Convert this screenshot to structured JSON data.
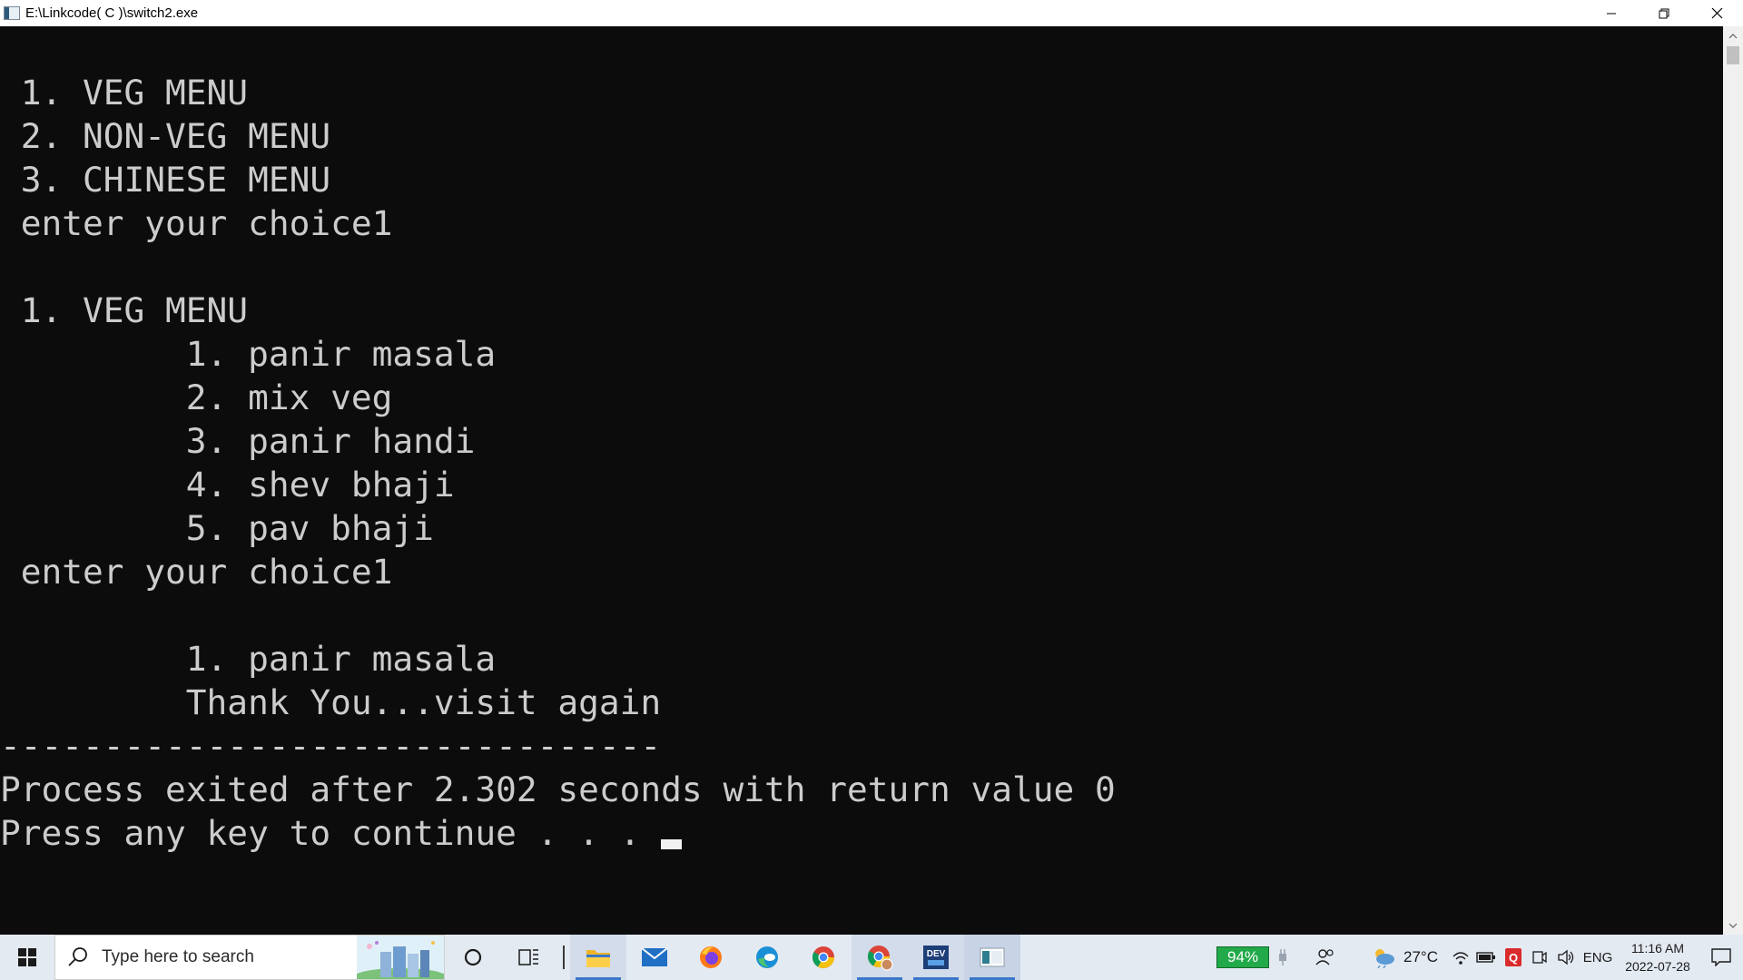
{
  "window": {
    "title": "E:\\Linkcode( C )\\switch2.exe"
  },
  "console": {
    "lines": [
      " 1. VEG MENU",
      " 2. NON-VEG MENU",
      " 3. CHINESE MENU",
      " enter your choice1",
      "",
      " 1. VEG MENU",
      "         1. panir masala",
      "         2. mix veg",
      "         3. panir handi",
      "         4. shev bhaji",
      "         5. pav bhaji",
      " enter your choice1",
      "",
      "         1. panir masala",
      "         Thank You...visit again",
      "--------------------------------",
      "Process exited after 2.302 seconds with return value 0",
      "Press any key to continue . . ."
    ]
  },
  "taskbar": {
    "search_placeholder": "Type here to search",
    "apps": [
      {
        "name": "cortana-icon",
        "active": false
      },
      {
        "name": "task-view-icon",
        "active": false
      },
      {
        "name": "file-explorer-icon",
        "active": true
      },
      {
        "name": "mail-icon",
        "active": false
      },
      {
        "name": "firefox-icon",
        "active": false
      },
      {
        "name": "edge-icon",
        "active": false
      },
      {
        "name": "chrome-icon",
        "active": false
      },
      {
        "name": "chrome-profile-icon",
        "active": true
      },
      {
        "name": "dev-cpp-icon",
        "active": true
      },
      {
        "name": "console-app-icon",
        "active": true
      }
    ],
    "tray": {
      "battery_percent": "94%",
      "temperature": "27°C",
      "language": "ENG",
      "time": "11:16 AM",
      "date": "2022-07-28"
    }
  },
  "colors": {
    "console_bg": "#0c0c0c",
    "console_fg": "#cccccc",
    "taskbar_bg": "#e4eaf2",
    "battery_green": "#22a94a",
    "accent": "#3a78c8"
  }
}
